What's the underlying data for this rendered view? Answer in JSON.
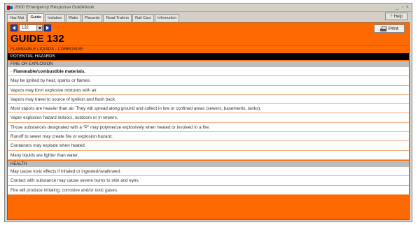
{
  "window": {
    "title": "2000 Emergency Response Guidebook",
    "controls": "_|&#9633;|x"
  },
  "tabs": [
    {
      "label": "Haz Mat",
      "active": false
    },
    {
      "label": "Guide",
      "active": true
    },
    {
      "label": "Isolation",
      "active": false
    },
    {
      "label": "Water",
      "active": false
    },
    {
      "label": "Placards",
      "active": false
    },
    {
      "label": "Road Trailers",
      "active": false
    },
    {
      "label": "Rail Cars",
      "active": false
    },
    {
      "label": "Information",
      "active": false
    }
  ],
  "help_label": "Help",
  "toolbar": {
    "guide_number": "132",
    "print_label": "Print"
  },
  "guide": {
    "title": "GUIDE 132",
    "subtitle": "FLAMMABLE LIQUIDS - CORROSIVE",
    "section": "POTENTIAL HAZARDS",
    "fire_heading": "FIRE OR EXPLOSION",
    "fire_items": [
      {
        "text": "Flammable/combustible materials.",
        "bold": true
      },
      {
        "text": "May be ignited by heat, sparks or flames.",
        "bold": false
      },
      {
        "text": "Vapors may form explosive mixtures with air.",
        "bold": false
      },
      {
        "text": "Vapors may travel to source of ignition and flash back.",
        "bold": false
      },
      {
        "text": "Most vapors are heavier than air. They will spread along ground and collect in low or confined areas (sewers, basements, tanks).",
        "bold": false
      },
      {
        "text": "Vapor explosion hazard indoors, outdoors or in sewers.",
        "bold": false
      },
      {
        "text": "Those substances designated with a \"P\" may polymerize explosively when heated or involved in a fire.",
        "bold": false
      },
      {
        "text": "Runoff to sewer may create fire or explosion hazard.",
        "bold": false
      },
      {
        "text": "Containers may explode when heated.",
        "bold": false
      },
      {
        "text": "Many liquids are lighter than water.",
        "bold": false
      }
    ],
    "health_heading": "HEALTH",
    "health_items": [
      {
        "text": "May cause toxic effects if inhaled or ingested/swallowed.",
        "bold": false
      },
      {
        "text": "Contact with substance may cause severe burns to skin and eyes.",
        "bold": false
      },
      {
        "text": "Fire will produce irritating, corrosive and/or toxic gases.",
        "bold": false
      }
    ]
  },
  "colors": {
    "accent": "#ff6a00",
    "nav_button": "#1a3fb0",
    "section_black": "#000000",
    "section_gray": "#bdbdbd"
  }
}
